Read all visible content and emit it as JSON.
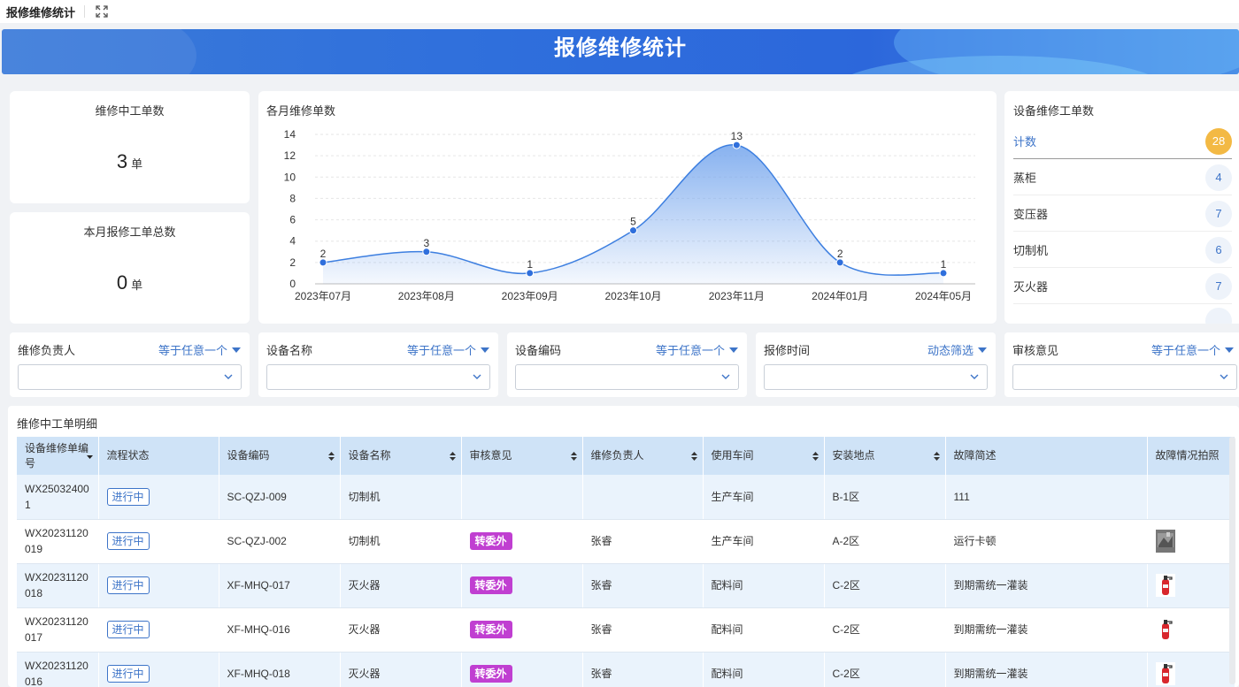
{
  "topbar": {
    "title": "报修维修统计"
  },
  "banner": {
    "title": "报修维修统计"
  },
  "stats": {
    "in_progress": {
      "title": "维修中工单数",
      "value": "3",
      "unit": "单"
    },
    "this_month": {
      "title": "本月报修工单总数",
      "value": "0",
      "unit": "单"
    }
  },
  "monthly_chart": {
    "title": "各月维修单数"
  },
  "chart_data": {
    "type": "area",
    "categories": [
      "2023年07月",
      "2023年08月",
      "2023年09月",
      "2023年10月",
      "2023年11月",
      "2024年01月",
      "2024年05月"
    ],
    "values": [
      2,
      3,
      1,
      5,
      13,
      2,
      1
    ],
    "ylim": [
      0,
      14
    ],
    "yticks": [
      0,
      2,
      4,
      6,
      8,
      10,
      12,
      14
    ],
    "grid": true,
    "line_color": "#3d7fe0",
    "fill_color": "#7aa9ee"
  },
  "device_counts": {
    "title": "设备维修工单数",
    "total": {
      "label": "计数",
      "value": "28"
    },
    "items": [
      {
        "label": "蒸柜",
        "value": "4"
      },
      {
        "label": "变压器",
        "value": "7"
      },
      {
        "label": "切制机",
        "value": "6"
      },
      {
        "label": "灭火器",
        "value": "7"
      }
    ]
  },
  "filters": [
    {
      "label": "维修负责人",
      "mode": "等于任意一个"
    },
    {
      "label": "设备名称",
      "mode": "等于任意一个"
    },
    {
      "label": "设备编码",
      "mode": "等于任意一个"
    },
    {
      "label": "报修时间",
      "mode": "动态筛选"
    },
    {
      "label": "审核意见",
      "mode": "等于任意一个"
    }
  ],
  "table": {
    "title": "维修中工单明细",
    "columns": [
      "设备维修单编号",
      "流程状态",
      "设备编码",
      "设备名称",
      "审核意见",
      "维修负责人",
      "使用车间",
      "安装地点",
      "故障简述",
      "故障情况拍照"
    ],
    "rows": [
      {
        "id": "WX250324001",
        "status": "进行中",
        "code": "SC-QZJ-009",
        "name": "切制机",
        "audit": "",
        "owner": "",
        "workshop": "生产车间",
        "location": "B-1区",
        "desc": "111",
        "photo": ""
      },
      {
        "id": "WX20231120019",
        "status": "进行中",
        "code": "SC-QZJ-002",
        "name": "切制机",
        "audit": "转委外",
        "owner": "张睿",
        "workshop": "生产车间",
        "location": "A-2区",
        "desc": "运行卡顿",
        "photo": "machine-photo"
      },
      {
        "id": "WX20231120018",
        "status": "进行中",
        "code": "XF-MHQ-017",
        "name": "灭火器",
        "audit": "转委外",
        "owner": "张睿",
        "workshop": "配料间",
        "location": "C-2区",
        "desc": "到期需统一灌装",
        "photo": "extinguisher-photo"
      },
      {
        "id": "WX20231120017",
        "status": "进行中",
        "code": "XF-MHQ-016",
        "name": "灭火器",
        "audit": "转委外",
        "owner": "张睿",
        "workshop": "配料间",
        "location": "C-2区",
        "desc": "到期需统一灌装",
        "photo": "extinguisher-photo"
      },
      {
        "id": "WX20231120016",
        "status": "进行中",
        "code": "XF-MHQ-018",
        "name": "灭火器",
        "audit": "转委外",
        "owner": "张睿",
        "workshop": "配料间",
        "location": "C-2区",
        "desc": "到期需统一灌装",
        "photo": "extinguisher-photo"
      }
    ]
  }
}
